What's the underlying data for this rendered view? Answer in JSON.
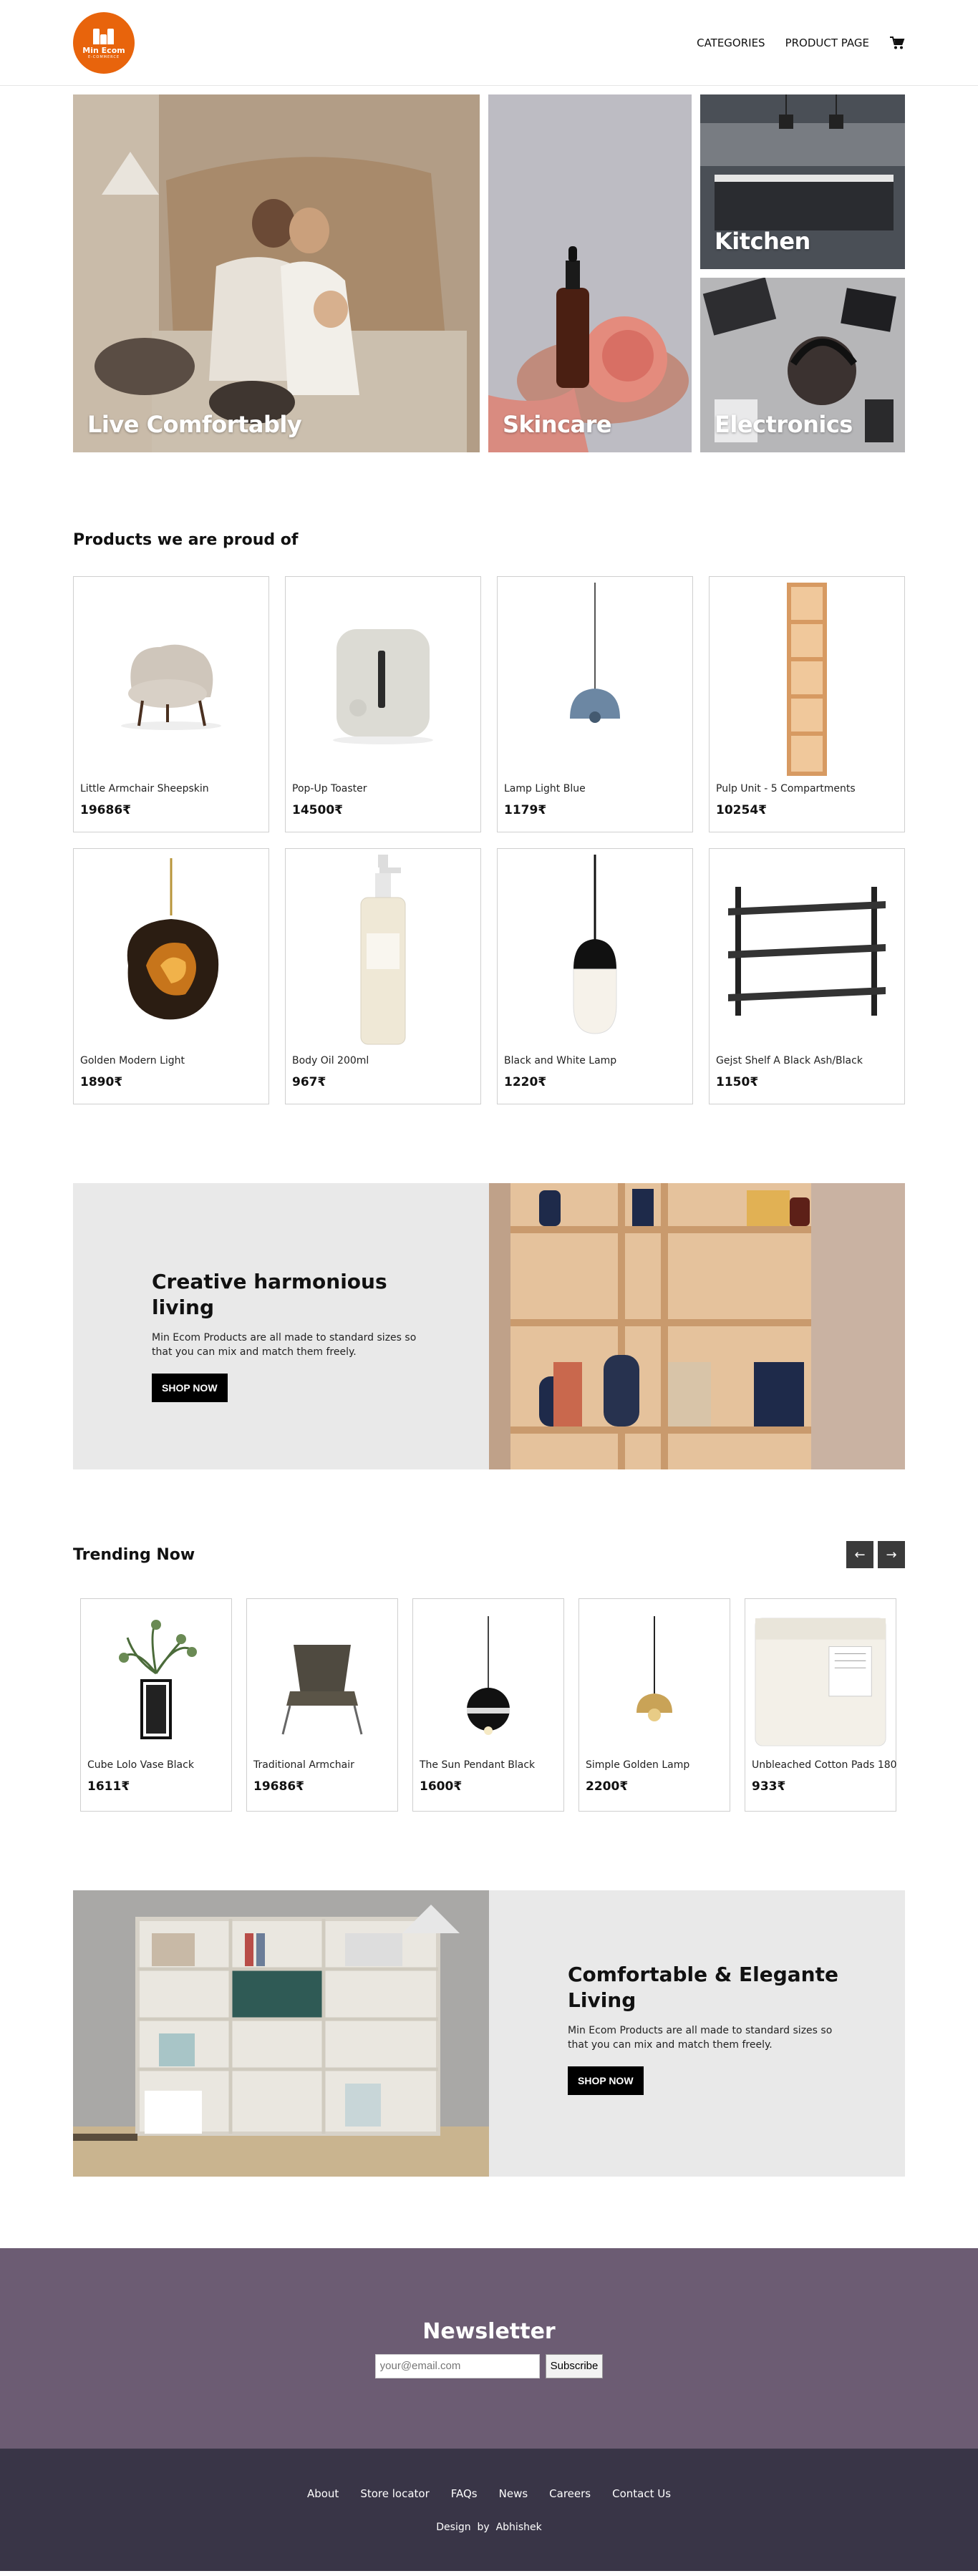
{
  "header": {
    "logo": {
      "line1": "Min Ecom",
      "line2": "E-COMMERCE"
    },
    "nav": [
      {
        "label": "CATEGORIES"
      },
      {
        "label": "PRODUCT PAGE"
      }
    ],
    "cart_icon": "cart-icon"
  },
  "hero": {
    "tiles": [
      {
        "label": "Live Comfortably"
      },
      {
        "label": "Skincare"
      },
      {
        "label": "Kitchen"
      },
      {
        "label": "Electronics"
      }
    ]
  },
  "proud": {
    "title": "Products we are proud of",
    "items": [
      {
        "name": "Little Armchair Sheepskin",
        "price": "19686₹",
        "icon": "armchair"
      },
      {
        "name": "Pop-Up Toaster",
        "price": "14500₹",
        "icon": "toaster"
      },
      {
        "name": "Lamp Light Blue",
        "price": "1179₹",
        "icon": "pendant-lamp"
      },
      {
        "name": "Pulp Unit - 5 Compartments",
        "price": "10254₹",
        "icon": "shelf-unit"
      },
      {
        "name": "Golden Modern Light",
        "price": "1890₹",
        "icon": "golden-lamp"
      },
      {
        "name": "Body Oil 200ml",
        "price": "967₹",
        "icon": "bottle"
      },
      {
        "name": "Black and White Lamp",
        "price": "1220₹",
        "icon": "bulb-lamp"
      },
      {
        "name": "Gejst Shelf A Black Ash/Black",
        "price": "1150₹",
        "icon": "wall-shelf"
      }
    ]
  },
  "promo1": {
    "title": "Creative harmonious living",
    "text": "Min Ecom Products are all made to standard sizes so that you can mix and match them freely.",
    "button": "SHOP NOW"
  },
  "trending": {
    "title": "Trending Now",
    "prev": "←",
    "next": "→",
    "items": [
      {
        "name": "Cube Lolo Vase Black",
        "price": "1611₹",
        "icon": "vase"
      },
      {
        "name": "Traditional Armchair",
        "price": "19686₹",
        "icon": "armchair"
      },
      {
        "name": "The Sun Pendant Black",
        "price": "1600₹",
        "icon": "pendant-black"
      },
      {
        "name": "Simple Golden Lamp",
        "price": "2200₹",
        "icon": "golden-pendant"
      },
      {
        "name": "Unbleached Cotton Pads 180",
        "price": "933₹",
        "icon": "cotton-pads"
      }
    ]
  },
  "promo2": {
    "title": "Comfortable & Elegante Living",
    "text": "Min Ecom Products are all made to standard sizes so that you can mix and match them freely.",
    "button": "SHOP NOW"
  },
  "newsletter": {
    "title": "Newsletter",
    "placeholder": "your@email.com",
    "button": "Subscribe"
  },
  "footer": {
    "links": [
      {
        "label": "About"
      },
      {
        "label": "Store locator"
      },
      {
        "label": "FAQs"
      },
      {
        "label": "News"
      },
      {
        "label": "Careers"
      },
      {
        "label": "Contact Us"
      }
    ],
    "credit": "Design  by  Abhishek"
  },
  "colors": {
    "brand": "#e8640c",
    "newsletter_bg": "#6c5c73",
    "footer_bg": "#393547"
  }
}
